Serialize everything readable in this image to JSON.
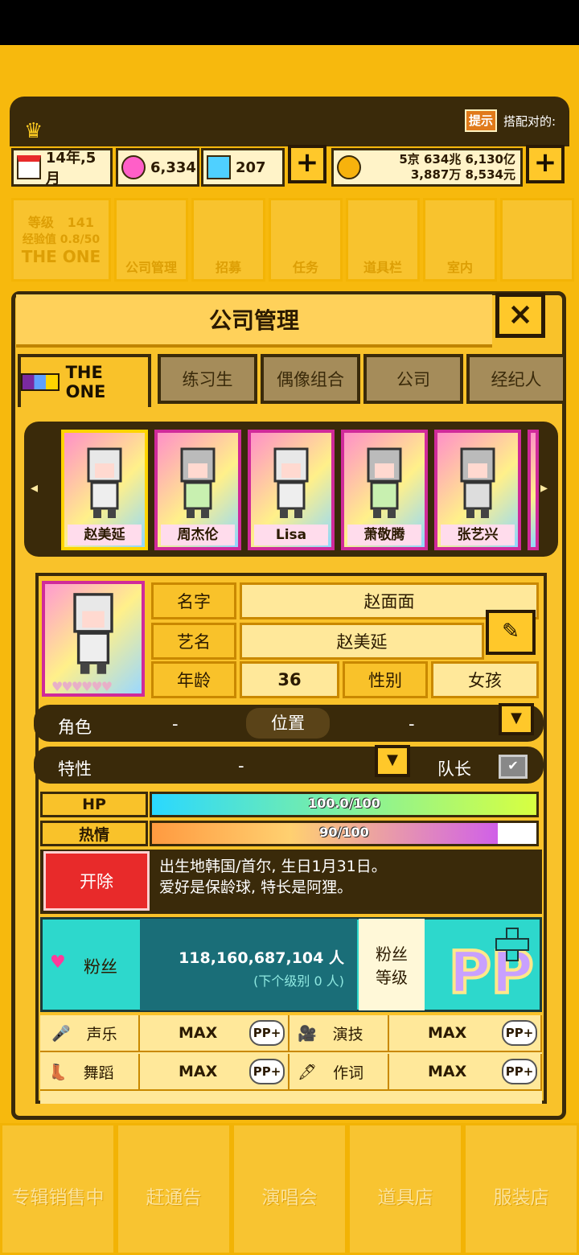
{
  "colors": {
    "bg": "#f7b90d",
    "dark": "#3a2a0a",
    "fire_red": "#e82a2a",
    "fan_cyan": "#2dd8cc"
  },
  "header": {
    "hint_badge": "提示",
    "hint_text": "搭配对的:"
  },
  "stats": {
    "date": "14年,5月",
    "gems": "6,334",
    "diamonds": "207",
    "money_line1": "5京 634兆 6,130亿",
    "money_line2": "3,887万 8,534元",
    "plus": "+"
  },
  "top_nav": {
    "level_label": "等级",
    "level_value": "141",
    "exp_label": "经验值 0.8/50",
    "group_name": "THE ONE",
    "items": [
      "公司管理",
      "招募",
      "任务",
      "道具栏",
      "室内",
      ""
    ]
  },
  "modal": {
    "title": "公司管理",
    "close": "×",
    "tabs": [
      "THE ONE",
      "练习生",
      "偶像组合",
      "公司",
      "经纪人"
    ]
  },
  "roster": {
    "members": [
      "赵美延",
      "周杰伦",
      "Lisa",
      "萧敬腾",
      "张艺兴"
    ],
    "left_arrow": "◂",
    "right_arrow": "▸"
  },
  "profile": {
    "name_label": "名字",
    "name_value": "赵面面",
    "stage_label": "艺名",
    "stage_value": "赵美延",
    "age_label": "年龄",
    "age_value": "36",
    "gender_label": "性别",
    "gender_value": "女孩",
    "role_label": "角色",
    "role_value": "-",
    "position_label": "位置",
    "position_value": "-",
    "trait_label": "特性",
    "trait_value": "-",
    "leader_label": "队长",
    "hp_label": "HP",
    "hp_text": "100.0/100",
    "hp_fraction": 1.0,
    "passion_label": "热情",
    "passion_text": "90/100",
    "passion_fraction": 0.9,
    "fire_button": "开除",
    "bio_line1": "出生地韩国/首尔, 生日1月31日。",
    "bio_line2": "爱好是保龄球, 特长是阿狸。"
  },
  "fans": {
    "label": "粉丝",
    "count": "118,160,687,104 人",
    "next_level": "(下个级别 0 人)",
    "level_label_1": "粉丝",
    "level_label_2": "等级"
  },
  "skills": [
    {
      "name": "声乐",
      "value": "MAX",
      "pp": "PP+"
    },
    {
      "name": "演技",
      "value": "MAX",
      "pp": "PP+"
    },
    {
      "name": "舞蹈",
      "value": "MAX",
      "pp": "PP+"
    },
    {
      "name": "作词",
      "value": "MAX",
      "pp": "PP+"
    }
  ],
  "bottom_nav": [
    "专辑销售中",
    "赶通告",
    "演唱会",
    "道具店",
    "服装店"
  ]
}
